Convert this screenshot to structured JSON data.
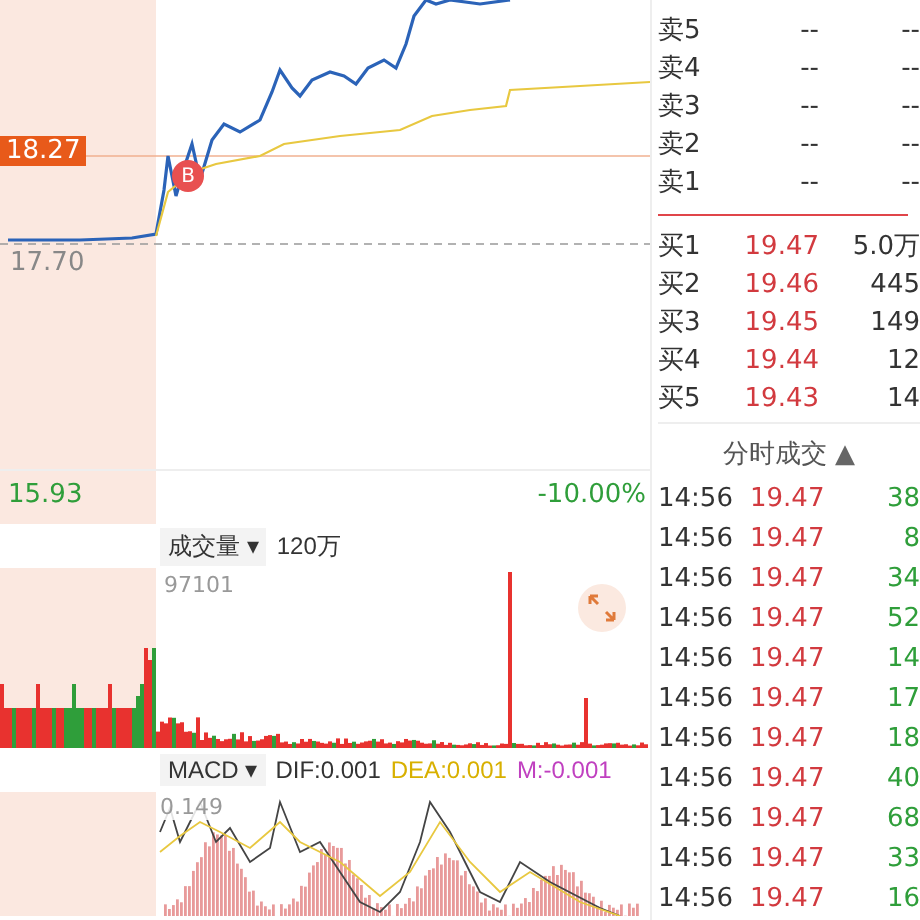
{
  "price_chart": {
    "labels": [
      {
        "text": "18.27",
        "kind": "marker"
      },
      {
        "text": "17.70",
        "kind": "base"
      }
    ],
    "low": "15.93",
    "low_change": "-10.00%",
    "trade_marker": "B"
  },
  "volume": {
    "indicator": "成交量",
    "caret": "▾",
    "scale": "120万",
    "peak": "97101"
  },
  "macd": {
    "indicator": "MACD",
    "caret": "▾",
    "dif": "DIF:0.001",
    "dea": "DEA:0.001",
    "m": "M:-0.001",
    "peak": "0.149"
  },
  "order_book": {
    "asks": [
      {
        "label": "卖5",
        "price": "--",
        "volume": "--"
      },
      {
        "label": "卖4",
        "price": "--",
        "volume": "--"
      },
      {
        "label": "卖3",
        "price": "--",
        "volume": "--"
      },
      {
        "label": "卖2",
        "price": "--",
        "volume": "--"
      },
      {
        "label": "卖1",
        "price": "--",
        "volume": "--"
      }
    ],
    "bids": [
      {
        "label": "买1",
        "price": "19.47",
        "volume": "5.0万"
      },
      {
        "label": "买2",
        "price": "19.46",
        "volume": "445"
      },
      {
        "label": "买3",
        "price": "19.45",
        "volume": "149"
      },
      {
        "label": "买4",
        "price": "19.44",
        "volume": "12"
      },
      {
        "label": "买5",
        "price": "19.43",
        "volume": "14"
      }
    ]
  },
  "trades": {
    "title": "分时成交",
    "toggle": "▲",
    "rows": [
      {
        "time": "14:56",
        "price": "19.47",
        "volume": "38"
      },
      {
        "time": "14:56",
        "price": "19.47",
        "volume": "8"
      },
      {
        "time": "14:56",
        "price": "19.47",
        "volume": "34"
      },
      {
        "time": "14:56",
        "price": "19.47",
        "volume": "52"
      },
      {
        "time": "14:56",
        "price": "19.47",
        "volume": "14"
      },
      {
        "time": "14:56",
        "price": "19.47",
        "volume": "17"
      },
      {
        "time": "14:56",
        "price": "19.47",
        "volume": "18"
      },
      {
        "time": "14:56",
        "price": "19.47",
        "volume": "40"
      },
      {
        "time": "14:56",
        "price": "19.47",
        "volume": "68"
      },
      {
        "time": "14:56",
        "price": "19.47",
        "volume": "33"
      },
      {
        "time": "14:56",
        "price": "19.47",
        "volume": "16"
      }
    ]
  }
}
